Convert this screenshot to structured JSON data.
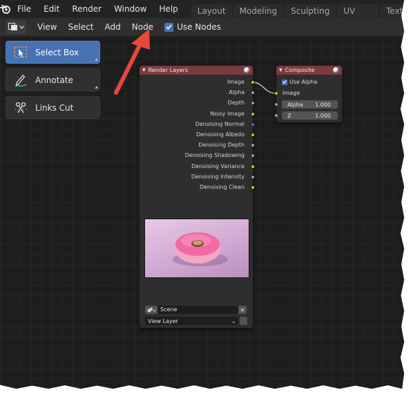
{
  "menu": {
    "items": [
      "File",
      "Edit",
      "Render",
      "Window",
      "Help"
    ],
    "workspace_tabs": [
      "Layout",
      "Modeling",
      "Sculpting",
      "UV Editing",
      "Textur"
    ]
  },
  "header": {
    "items": [
      "View",
      "Select",
      "Add",
      "Node"
    ],
    "use_nodes_label": "Use Nodes",
    "use_nodes_checked": true
  },
  "toolbar": {
    "select_box": "Select Box",
    "annotate": "Annotate",
    "links_cut": "Links Cut"
  },
  "render_layers_node": {
    "title": "Render Layers",
    "outputs": [
      {
        "label": "Image",
        "socket": "yellow"
      },
      {
        "label": "Alpha",
        "socket": "grey"
      },
      {
        "label": "Depth",
        "socket": "grey"
      },
      {
        "label": "Noisy Image",
        "socket": "yellow"
      },
      {
        "label": "Denoising Normal",
        "socket": "blue"
      },
      {
        "label": "Denoising Albedo",
        "socket": "yellow"
      },
      {
        "label": "Denoising Depth",
        "socket": "grey"
      },
      {
        "label": "Denoising Shadowing",
        "socket": "grey"
      },
      {
        "label": "Denoising Variance",
        "socket": "yellow"
      },
      {
        "label": "Denoising Intensity",
        "socket": "grey"
      },
      {
        "label": "Denoising Clean",
        "socket": "yellow"
      }
    ],
    "scene": "Scene",
    "view_layer": "View Layer"
  },
  "composite_node": {
    "title": "Composite",
    "use_alpha_label": "Use Alpha",
    "use_alpha_checked": true,
    "image_label": "Image",
    "alpha_label": "Alpha",
    "alpha_value": "1.000",
    "z_label": "Z",
    "z_value": "1.000"
  },
  "colors": {
    "accent": "#4772b3",
    "node_header": "#7c3a3f",
    "arrow": "#e8473c"
  }
}
